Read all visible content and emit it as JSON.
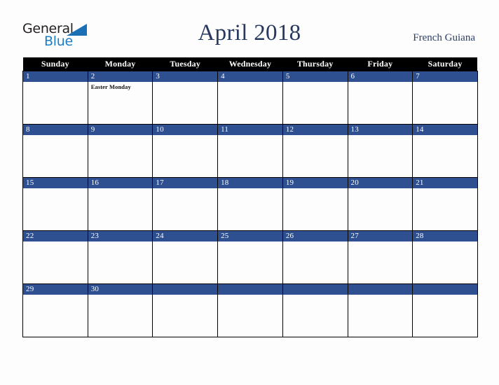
{
  "logo": {
    "word_one": "General",
    "word_two": "Blue",
    "triangle_color": "#1b6fb5",
    "word_two_color": "#1d7dc4"
  },
  "header": {
    "title": "April 2018",
    "location": "French Guiana",
    "title_color": "#27395e"
  },
  "calendar": {
    "accent_color": "#2e5090",
    "header_bg": "#000000",
    "weekday_headers": [
      "Sunday",
      "Monday",
      "Tuesday",
      "Wednesday",
      "Thursday",
      "Friday",
      "Saturday"
    ],
    "weeks": [
      [
        {
          "date": "1",
          "events": []
        },
        {
          "date": "2",
          "events": [
            "Easter Monday"
          ]
        },
        {
          "date": "3",
          "events": []
        },
        {
          "date": "4",
          "events": []
        },
        {
          "date": "5",
          "events": []
        },
        {
          "date": "6",
          "events": []
        },
        {
          "date": "7",
          "events": []
        }
      ],
      [
        {
          "date": "8",
          "events": []
        },
        {
          "date": "9",
          "events": []
        },
        {
          "date": "10",
          "events": []
        },
        {
          "date": "11",
          "events": []
        },
        {
          "date": "12",
          "events": []
        },
        {
          "date": "13",
          "events": []
        },
        {
          "date": "14",
          "events": []
        }
      ],
      [
        {
          "date": "15",
          "events": []
        },
        {
          "date": "16",
          "events": []
        },
        {
          "date": "17",
          "events": []
        },
        {
          "date": "18",
          "events": []
        },
        {
          "date": "19",
          "events": []
        },
        {
          "date": "20",
          "events": []
        },
        {
          "date": "21",
          "events": []
        }
      ],
      [
        {
          "date": "22",
          "events": []
        },
        {
          "date": "23",
          "events": []
        },
        {
          "date": "24",
          "events": []
        },
        {
          "date": "25",
          "events": []
        },
        {
          "date": "26",
          "events": []
        },
        {
          "date": "27",
          "events": []
        },
        {
          "date": "28",
          "events": []
        }
      ],
      [
        {
          "date": "29",
          "events": []
        },
        {
          "date": "30",
          "events": []
        },
        {
          "date": "",
          "events": []
        },
        {
          "date": "",
          "events": []
        },
        {
          "date": "",
          "events": []
        },
        {
          "date": "",
          "events": []
        },
        {
          "date": "",
          "events": []
        }
      ]
    ]
  }
}
